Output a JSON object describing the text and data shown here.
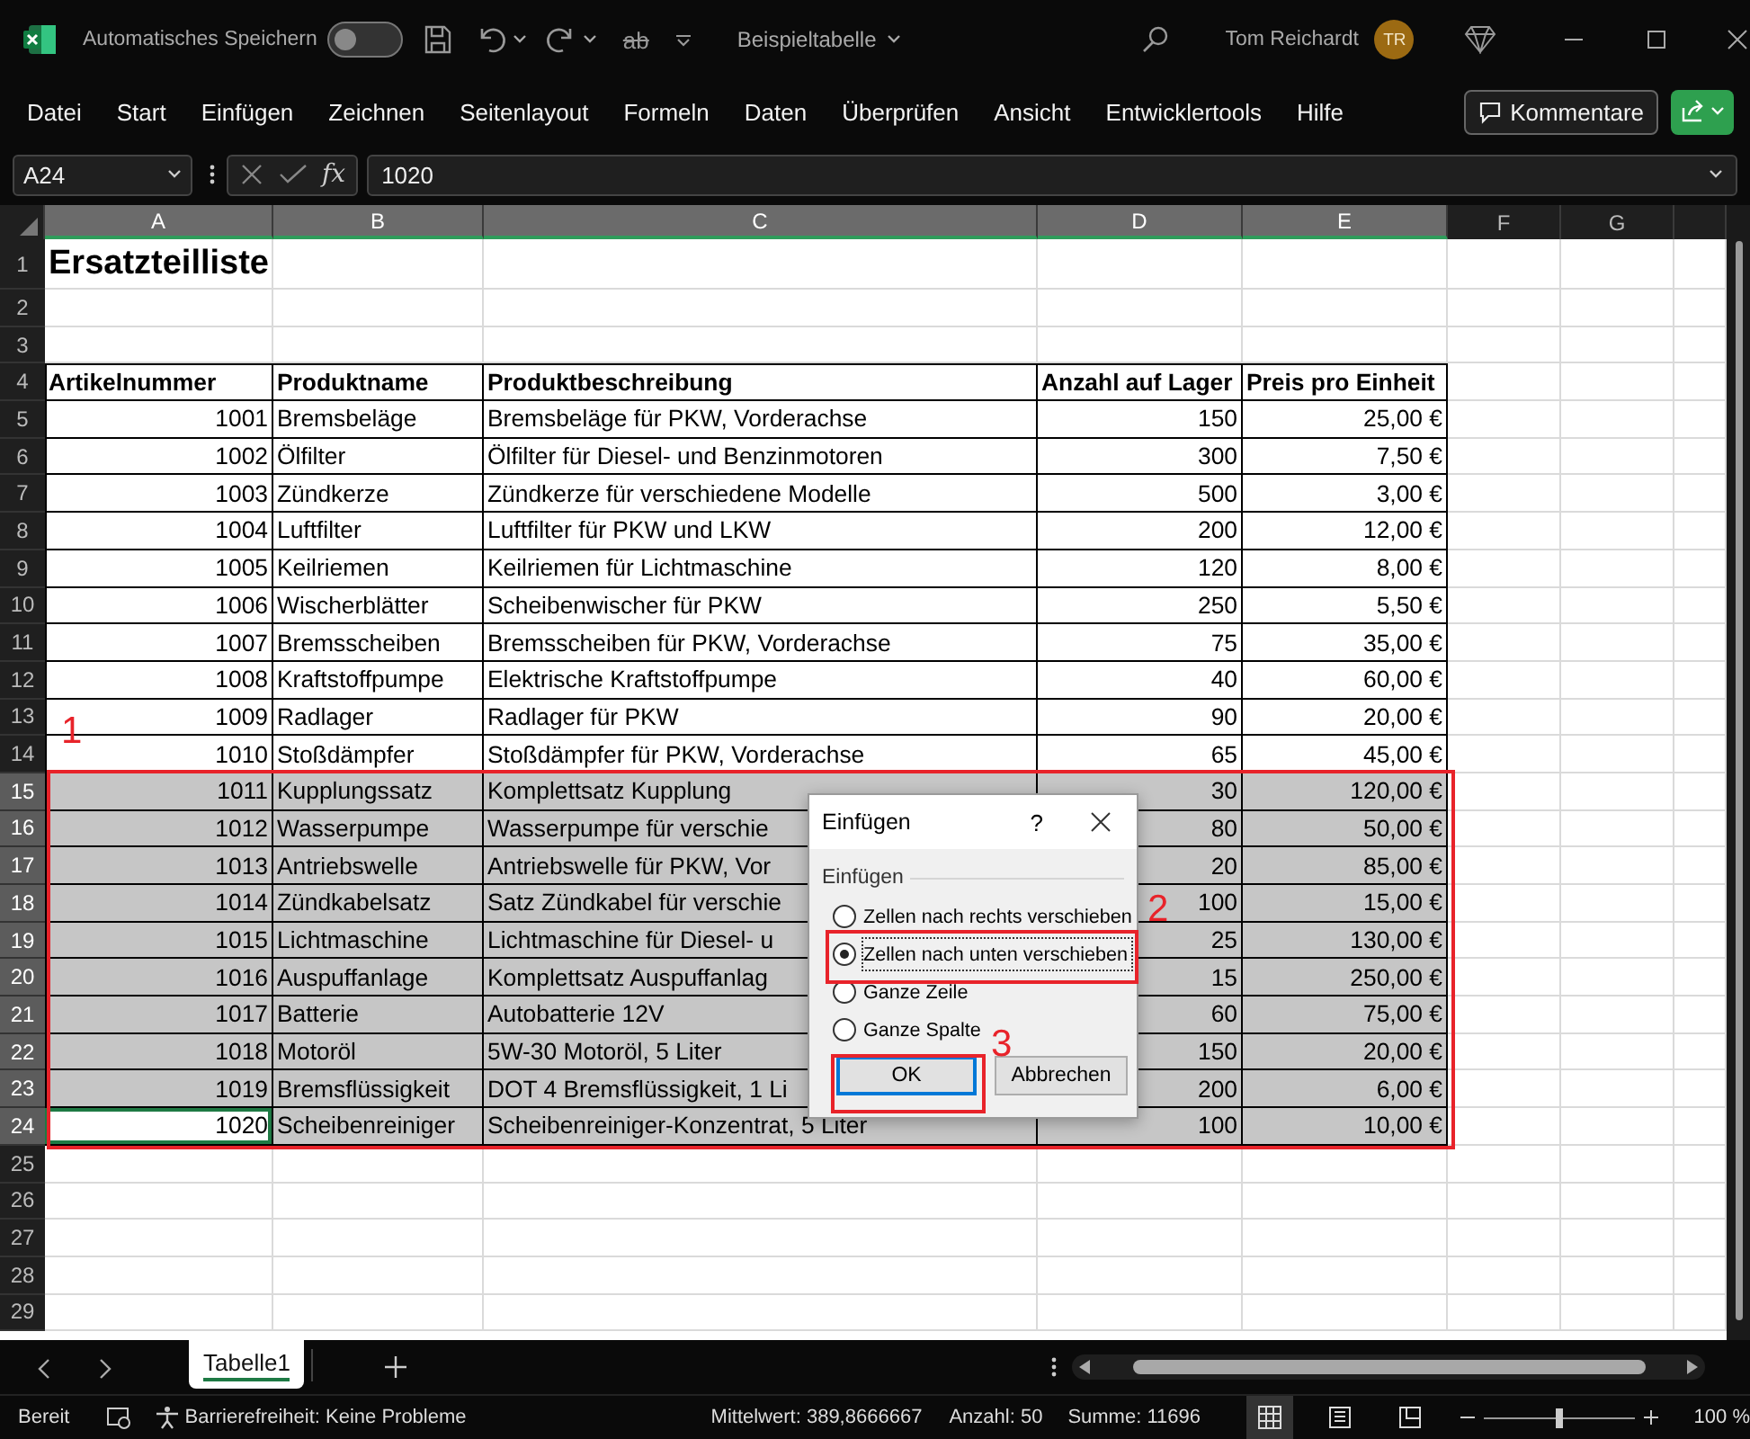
{
  "title_bar": {
    "autosave_label": "Automatisches Speichern",
    "autosave_on": false,
    "format_button": "ab",
    "document_title": "Beispieltabelle",
    "user_name": "Tom Reichardt",
    "avatar_initials": "TR"
  },
  "menu": [
    "Datei",
    "Start",
    "Einfügen",
    "Zeichnen",
    "Seitenlayout",
    "Formeln",
    "Daten",
    "Überprüfen",
    "Ansicht",
    "Entwicklertools",
    "Hilfe"
  ],
  "comments_button": "Kommentare",
  "formula_bar": {
    "name_box": "A24",
    "function_label": "fx",
    "value": "1020"
  },
  "sheet": {
    "columns": [
      {
        "letter": "A",
        "selected": true,
        "kind": "number"
      },
      {
        "letter": "B",
        "selected": true,
        "kind": "text"
      },
      {
        "letter": "C",
        "selected": true,
        "kind": "text"
      },
      {
        "letter": "D",
        "selected": true,
        "kind": "number"
      },
      {
        "letter": "E",
        "selected": true,
        "kind": "number"
      },
      {
        "letter": "F",
        "selected": false,
        "kind": "text"
      },
      {
        "letter": "G",
        "selected": false,
        "kind": "text"
      }
    ],
    "rows": [
      {
        "number": "1",
        "selected": false,
        "kind": "title",
        "cells": [
          {
            "text": "Ersatzteilliste",
            "active": false
          }
        ]
      },
      {
        "number": "2",
        "selected": false,
        "kind": "empty"
      },
      {
        "number": "3",
        "selected": false,
        "kind": "empty"
      },
      {
        "number": "4",
        "selected": false,
        "kind": "header",
        "cells": [
          {
            "text": "Artikelnummer",
            "active": false
          },
          {
            "text": "Produktname",
            "active": false
          },
          {
            "text": "Produktbeschreibung",
            "active": false
          },
          {
            "text": "Anzahl auf Lager",
            "active": false
          },
          {
            "text": "Preis pro Einheit",
            "active": false
          }
        ]
      },
      {
        "number": "5",
        "selected": false,
        "kind": "data",
        "cells": [
          {
            "text": "1001",
            "active": false
          },
          {
            "text": "Bremsbeläge",
            "active": false
          },
          {
            "text": "Bremsbeläge für PKW, Vorderachse",
            "active": false
          },
          {
            "text": "150",
            "active": false
          },
          {
            "text": "25,00 €",
            "active": false
          }
        ]
      },
      {
        "number": "6",
        "selected": false,
        "kind": "data",
        "cells": [
          {
            "text": "1002",
            "active": false
          },
          {
            "text": "Ölfilter",
            "active": false
          },
          {
            "text": "Ölfilter für Diesel- und Benzinmotoren",
            "active": false
          },
          {
            "text": "300",
            "active": false
          },
          {
            "text": "7,50 €",
            "active": false
          }
        ]
      },
      {
        "number": "7",
        "selected": false,
        "kind": "data",
        "cells": [
          {
            "text": "1003",
            "active": false
          },
          {
            "text": "Zündkerze",
            "active": false
          },
          {
            "text": "Zündkerze für verschiedene Modelle",
            "active": false
          },
          {
            "text": "500",
            "active": false
          },
          {
            "text": "3,00 €",
            "active": false
          }
        ]
      },
      {
        "number": "8",
        "selected": false,
        "kind": "data",
        "cells": [
          {
            "text": "1004",
            "active": false
          },
          {
            "text": "Luftfilter",
            "active": false
          },
          {
            "text": "Luftfilter für PKW und LKW",
            "active": false
          },
          {
            "text": "200",
            "active": false
          },
          {
            "text": "12,00 €",
            "active": false
          }
        ]
      },
      {
        "number": "9",
        "selected": false,
        "kind": "data",
        "cells": [
          {
            "text": "1005",
            "active": false
          },
          {
            "text": "Keilriemen",
            "active": false
          },
          {
            "text": "Keilriemen für Lichtmaschine",
            "active": false
          },
          {
            "text": "120",
            "active": false
          },
          {
            "text": "8,00 €",
            "active": false
          }
        ]
      },
      {
        "number": "10",
        "selected": false,
        "kind": "data",
        "cells": [
          {
            "text": "1006",
            "active": false
          },
          {
            "text": "Wischerblätter",
            "active": false
          },
          {
            "text": "Scheibenwischer für PKW",
            "active": false
          },
          {
            "text": "250",
            "active": false
          },
          {
            "text": "5,50 €",
            "active": false
          }
        ]
      },
      {
        "number": "11",
        "selected": false,
        "kind": "data",
        "cells": [
          {
            "text": "1007",
            "active": false
          },
          {
            "text": "Bremsscheiben",
            "active": false
          },
          {
            "text": "Bremsscheiben für PKW, Vorderachse",
            "active": false
          },
          {
            "text": "75",
            "active": false
          },
          {
            "text": "35,00 €",
            "active": false
          }
        ]
      },
      {
        "number": "12",
        "selected": false,
        "kind": "data",
        "cells": [
          {
            "text": "1008",
            "active": false
          },
          {
            "text": "Kraftstoffpumpe",
            "active": false
          },
          {
            "text": "Elektrische Kraftstoffpumpe",
            "active": false
          },
          {
            "text": "40",
            "active": false
          },
          {
            "text": "60,00 €",
            "active": false
          }
        ]
      },
      {
        "number": "13",
        "selected": false,
        "kind": "data",
        "cells": [
          {
            "text": "1009",
            "active": false
          },
          {
            "text": "Radlager",
            "active": false
          },
          {
            "text": "Radlager für PKW",
            "active": false
          },
          {
            "text": "90",
            "active": false
          },
          {
            "text": "20,00 €",
            "active": false
          }
        ]
      },
      {
        "number": "14",
        "selected": false,
        "kind": "data",
        "cells": [
          {
            "text": "1010",
            "active": false
          },
          {
            "text": "Stoßdämpfer",
            "active": false
          },
          {
            "text": "Stoßdämpfer für PKW, Vorderachse",
            "active": false
          },
          {
            "text": "65",
            "active": false
          },
          {
            "text": "45,00 €",
            "active": false
          }
        ]
      },
      {
        "number": "15",
        "selected": true,
        "kind": "data",
        "cells": [
          {
            "text": "1011",
            "active": false
          },
          {
            "text": "Kupplungssatz",
            "active": false
          },
          {
            "text": "Komplettsatz Kupplung",
            "active": false
          },
          {
            "text": "30",
            "active": false
          },
          {
            "text": "120,00 €",
            "active": false
          }
        ]
      },
      {
        "number": "16",
        "selected": true,
        "kind": "data",
        "cells": [
          {
            "text": "1012",
            "active": false
          },
          {
            "text": "Wasserpumpe",
            "active": false
          },
          {
            "text": "Wasserpumpe für verschie",
            "active": false
          },
          {
            "text": "80",
            "active": false
          },
          {
            "text": "50,00 €",
            "active": false
          }
        ]
      },
      {
        "number": "17",
        "selected": true,
        "kind": "data",
        "cells": [
          {
            "text": "1013",
            "active": false
          },
          {
            "text": "Antriebswelle",
            "active": false
          },
          {
            "text": "Antriebswelle für PKW, Vor",
            "active": false
          },
          {
            "text": "20",
            "active": false
          },
          {
            "text": "85,00 €",
            "active": false
          }
        ]
      },
      {
        "number": "18",
        "selected": true,
        "kind": "data",
        "cells": [
          {
            "text": "1014",
            "active": false
          },
          {
            "text": "Zündkabelsatz",
            "active": false
          },
          {
            "text": "Satz Zündkabel für verschie",
            "active": false
          },
          {
            "text": "100",
            "active": false
          },
          {
            "text": "15,00 €",
            "active": false
          }
        ]
      },
      {
        "number": "19",
        "selected": true,
        "kind": "data",
        "cells": [
          {
            "text": "1015",
            "active": false
          },
          {
            "text": "Lichtmaschine",
            "active": false
          },
          {
            "text": "Lichtmaschine für Diesel- u",
            "active": false
          },
          {
            "text": "25",
            "active": false
          },
          {
            "text": "130,00 €",
            "active": false
          }
        ]
      },
      {
        "number": "20",
        "selected": true,
        "kind": "data",
        "cells": [
          {
            "text": "1016",
            "active": false
          },
          {
            "text": "Auspuffanlage",
            "active": false
          },
          {
            "text": "Komplettsatz Auspuffanlag",
            "active": false
          },
          {
            "text": "15",
            "active": false
          },
          {
            "text": "250,00 €",
            "active": false
          }
        ]
      },
      {
        "number": "21",
        "selected": true,
        "kind": "data",
        "cells": [
          {
            "text": "1017",
            "active": false
          },
          {
            "text": "Batterie",
            "active": false
          },
          {
            "text": "Autobatterie 12V",
            "active": false
          },
          {
            "text": "60",
            "active": false
          },
          {
            "text": "75,00 €",
            "active": false
          }
        ]
      },
      {
        "number": "22",
        "selected": true,
        "kind": "data",
        "cells": [
          {
            "text": "1018",
            "active": false
          },
          {
            "text": "Motoröl",
            "active": false
          },
          {
            "text": "5W-30 Motoröl, 5 Liter",
            "active": false
          },
          {
            "text": "150",
            "active": false
          },
          {
            "text": "20,00 €",
            "active": false
          }
        ]
      },
      {
        "number": "23",
        "selected": true,
        "kind": "data",
        "cells": [
          {
            "text": "1019",
            "active": false
          },
          {
            "text": "Bremsflüssigkeit",
            "active": false
          },
          {
            "text": "DOT 4 Bremsflüssigkeit, 1 Li",
            "active": false
          },
          {
            "text": "200",
            "active": false
          },
          {
            "text": "6,00 €",
            "active": false
          }
        ]
      },
      {
        "number": "24",
        "selected": true,
        "kind": "data",
        "cells": [
          {
            "text": "1020",
            "active": true
          },
          {
            "text": "Scheibenreiniger",
            "active": false
          },
          {
            "text": "Scheibenreiniger-Konzentrat, 5 Liter",
            "active": false
          },
          {
            "text": "100",
            "active": false
          },
          {
            "text": "10,00 €",
            "active": false
          }
        ]
      },
      {
        "number": "25",
        "selected": false,
        "kind": "empty"
      },
      {
        "number": "26",
        "selected": false,
        "kind": "empty"
      },
      {
        "number": "27",
        "selected": false,
        "kind": "empty"
      },
      {
        "number": "28",
        "selected": false,
        "kind": "empty"
      },
      {
        "number": "29",
        "selected": false,
        "kind": "empty"
      }
    ]
  },
  "dialog": {
    "title": "Einfügen",
    "help": "?",
    "group_label": "Einfügen",
    "options": [
      {
        "label": "Zellen nach rechts verschieben",
        "selected": false,
        "focused": false
      },
      {
        "label": "Zellen nach unten verschieben",
        "selected": true,
        "focused": true
      },
      {
        "label": "Ganze Zeile",
        "selected": false,
        "focused": false
      },
      {
        "label": "Ganze Spalte",
        "selected": false,
        "focused": false
      }
    ],
    "buttons": [
      {
        "label": "OK",
        "default": true
      },
      {
        "label": "Abbrechen",
        "default": false
      }
    ]
  },
  "annotations": [
    {
      "label": "1"
    },
    {
      "label": "2"
    },
    {
      "label": "3"
    }
  ],
  "sheet_tabs": [
    {
      "name": "Tabelle1",
      "selected": true
    }
  ],
  "status_bar": {
    "mode": "Bereit",
    "accessibility": "Barrierefreiheit: Keine Probleme",
    "average": "Mittelwert: 389,8666667",
    "count": "Anzahl: 50",
    "sum": "Summe: 11696",
    "views": [
      {
        "kind": "normal",
        "selected": true
      },
      {
        "kind": "page_layout",
        "selected": false
      },
      {
        "kind": "page_break",
        "selected": false
      }
    ],
    "zoom": {
      "level": 0.5,
      "reading": "100 %"
    }
  }
}
